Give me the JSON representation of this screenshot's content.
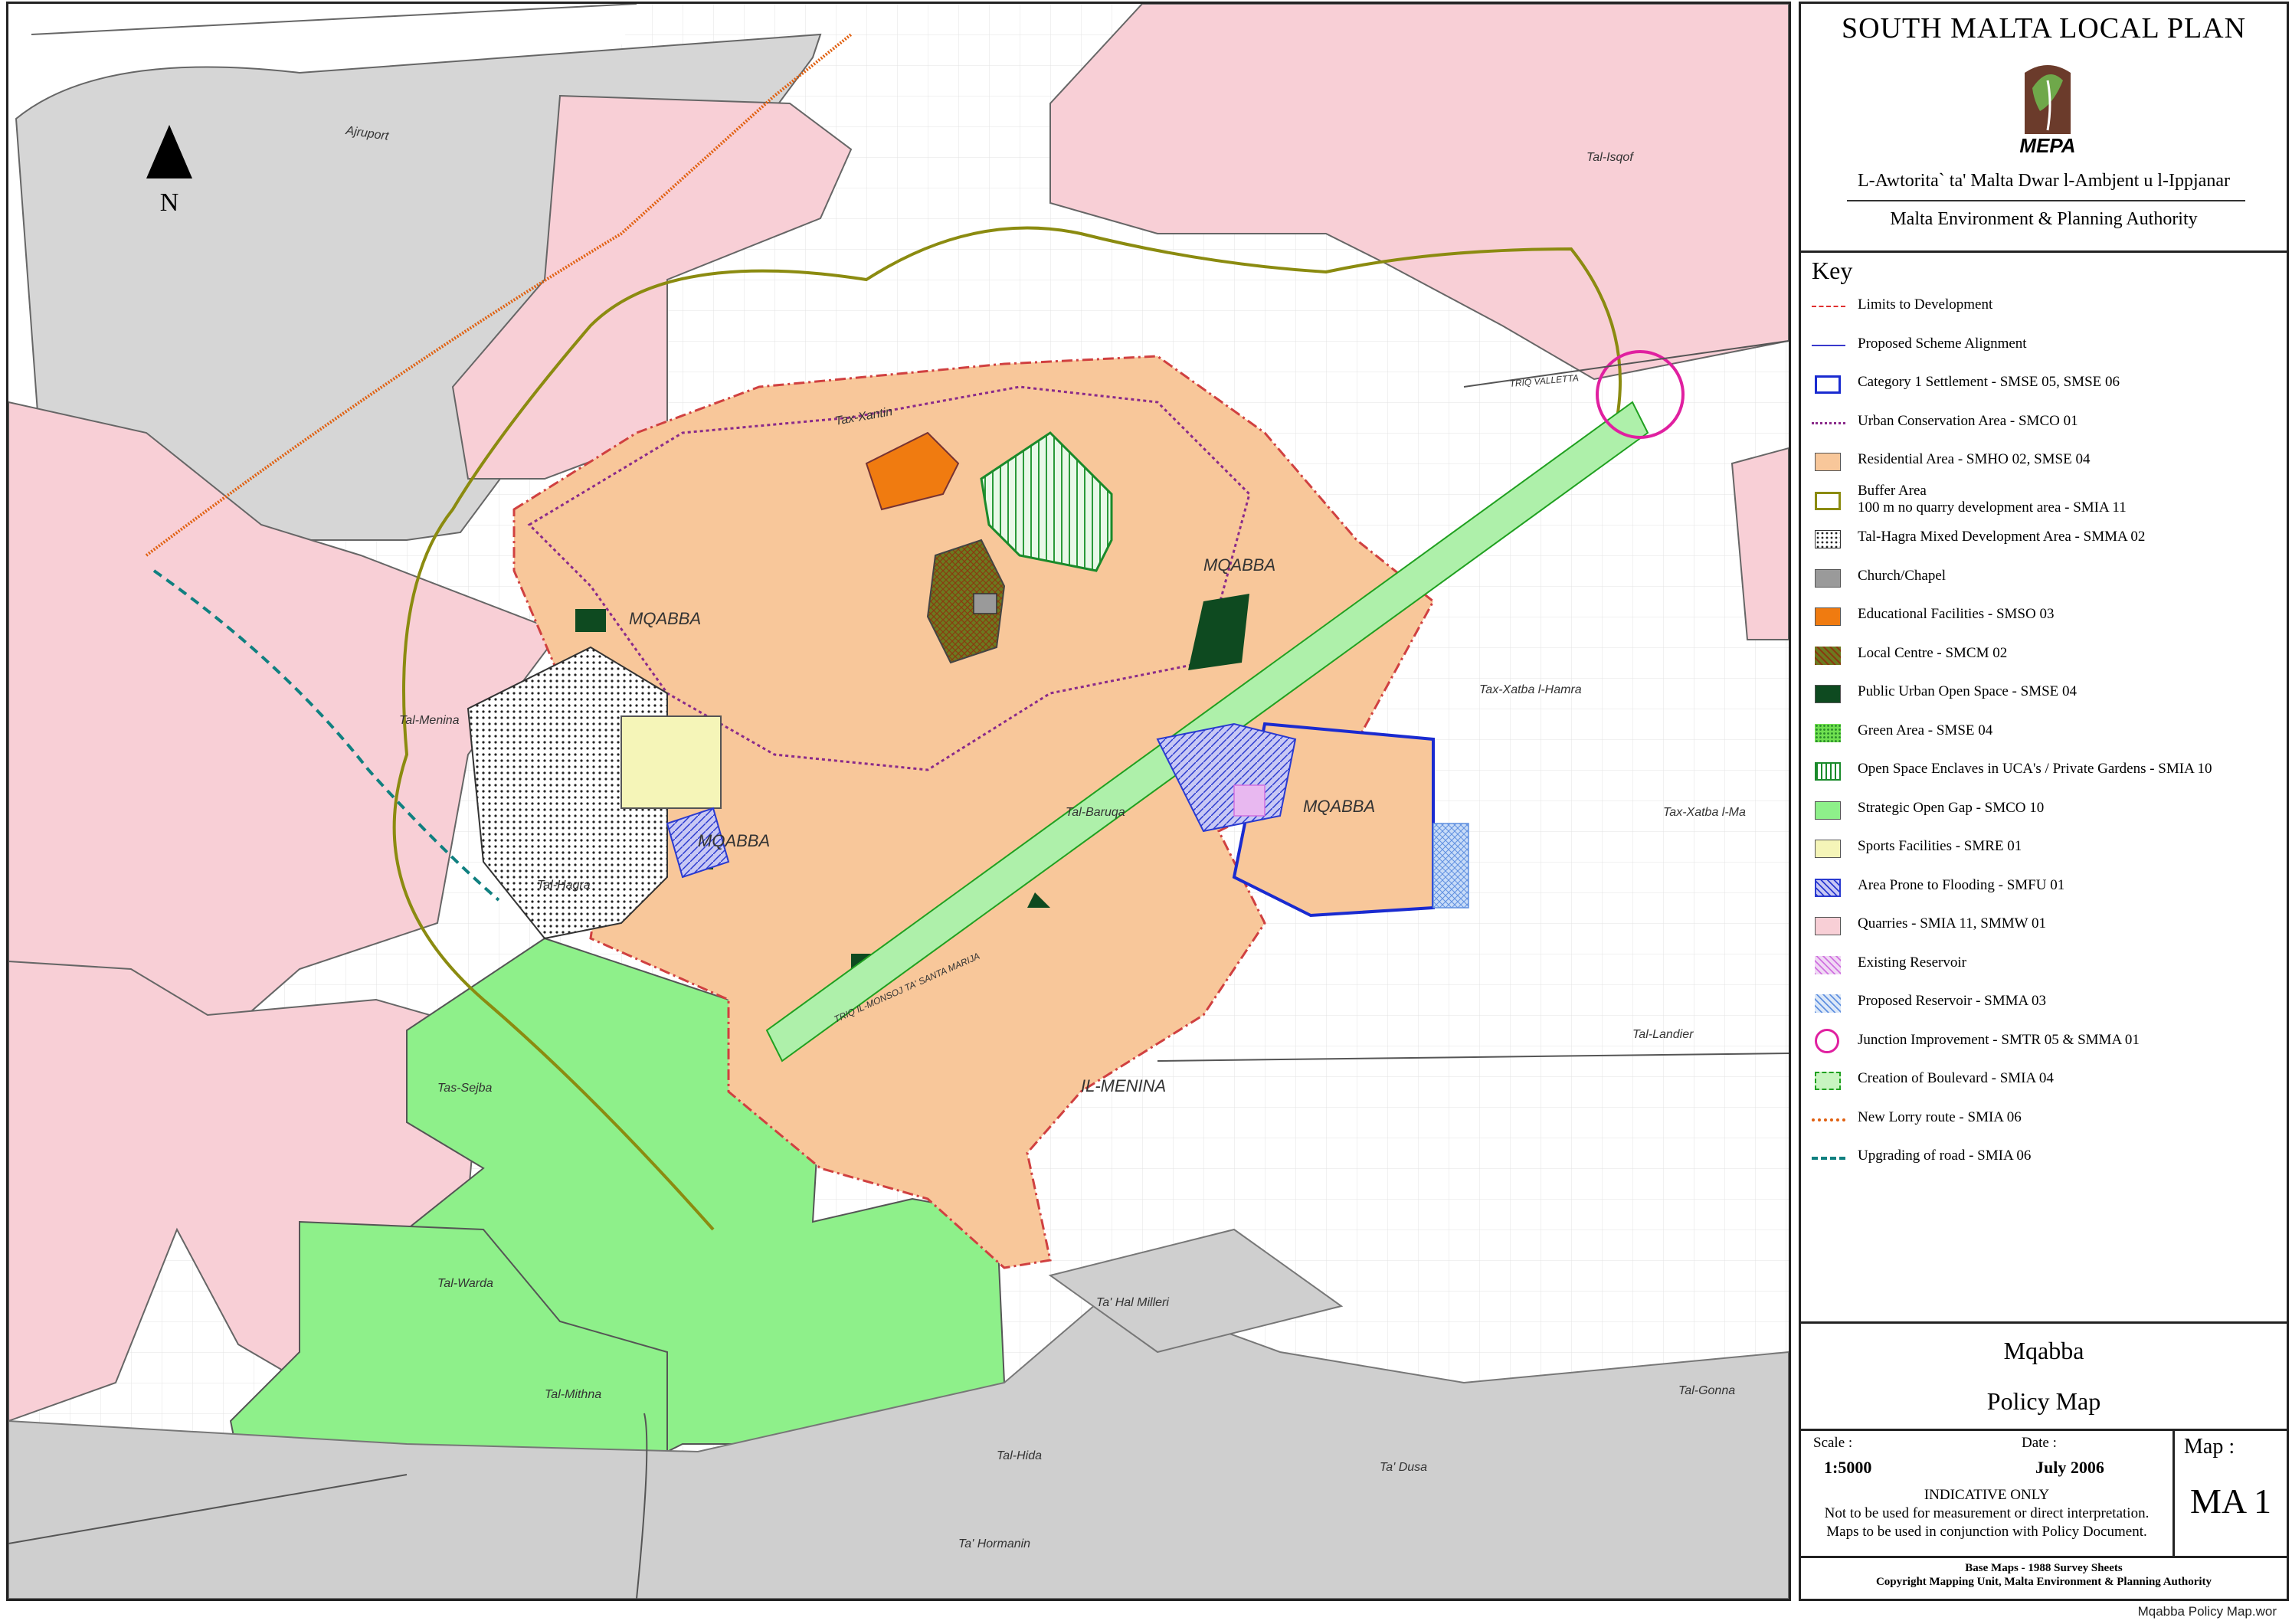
{
  "panel": {
    "plan_title": "SOUTH MALTA LOCAL PLAN",
    "logo_text": "MEPA",
    "authority_mt": "L-Awtorita` ta' Malta Dwar l-Ambjent u l-Ippjanar",
    "authority_en": "Malta Environment & Planning Authority",
    "key_title": "Key",
    "legend": [
      {
        "label": "Limits to Development",
        "swatch": "line-dashdot",
        "color": "#e03030"
      },
      {
        "label": "Proposed Scheme Alignment",
        "swatch": "line-solid",
        "color": "#3a3acc"
      },
      {
        "label": "Category 1 Settlement - SMSE 05, SMSE 06",
        "swatch": "outline",
        "color": "#1a2bd0"
      },
      {
        "label": "Urban Conservation Area - SMCO 01",
        "swatch": "line-dotted",
        "color": "#8a2a8a"
      },
      {
        "label": "Residential Area - SMHO 02, SMSE 04",
        "swatch": "fill",
        "color": "#f8c79a"
      },
      {
        "label": "Buffer Area",
        "label2": "100 m no quarry development area - SMIA 11",
        "swatch": "outline",
        "color": "#8b8b10"
      },
      {
        "label": "Tal-Hagra Mixed Development Area - SMMA 02",
        "swatch": "dots",
        "color": "#333333"
      },
      {
        "label": "Church/Chapel",
        "swatch": "fill",
        "color": "#9a9a9a"
      },
      {
        "label": "Educational Facilities - SMSO 03",
        "swatch": "fill",
        "color": "#f07b10"
      },
      {
        "label": "Local Centre - SMCM 02",
        "swatch": "hatch-brown",
        "color": "#7a5a10"
      },
      {
        "label": "Public Urban Open Space - SMSE 04",
        "swatch": "fill",
        "color": "#0e4a20"
      },
      {
        "label": "Green Area - SMSE 04",
        "swatch": "dots-green",
        "color": "#5fd040"
      },
      {
        "label": "Open Space Enclaves in UCA's / Private Gardens - SMIA 10",
        "swatch": "vlines",
        "color": "#1a8a2a"
      },
      {
        "label": "Strategic Open Gap - SMCO 10",
        "swatch": "fill",
        "color": "#8ef08a"
      },
      {
        "label": "Sports Facilities - SMRE 01",
        "swatch": "fill",
        "color": "#f5f5b8"
      },
      {
        "label": "Area Prone to Flooding - SMFU 01",
        "swatch": "hatch-blue",
        "color": "#2a3ad0"
      },
      {
        "label": "Quarries - SMIA 11, SMMW 01",
        "swatch": "fill",
        "color": "#f8cfd6"
      },
      {
        "label": "Existing Reservoir",
        "swatch": "hatch-pink",
        "color": "#d070e0"
      },
      {
        "label": "Proposed Reservoir - SMMA 03",
        "swatch": "hatch-lightblue",
        "color": "#6090e0"
      },
      {
        "label": "Junction Improvement - SMTR 05 & SMMA 01",
        "swatch": "circle",
        "color": "#e020a0"
      },
      {
        "label": "Creation of Boulevard - SMIA 04",
        "swatch": "dashbox",
        "color": "#20a020"
      },
      {
        "label": "New Lorry route - SMIA 06",
        "swatch": "line-orange",
        "color": "#e06010"
      },
      {
        "label": "Upgrading of road - SMIA 06",
        "swatch": "line-teal",
        "color": "#108080"
      }
    ],
    "place_name": "Mqabba",
    "map_type": "Policy Map",
    "scale_label": "Scale :",
    "scale_value": "1:5000",
    "date_label": "Date :",
    "date_value": "July 2006",
    "map_label": "Map :",
    "map_number": "MA 1",
    "indicative": "INDICATIVE ONLY",
    "disclaimer_1": "Not to be used for measurement or direct interpretation.",
    "disclaimer_2": "Maps to be used in conjunction with Policy Document.",
    "base_maps": "Base Maps - 1988 Survey Sheets",
    "copyright": "Copyright Mapping Unit, Malta Environment & Planning Authority"
  },
  "map": {
    "north_label": "N",
    "place_labels": {
      "airport": "Ajruport",
      "isqof": "Tal-Isqof",
      "xantin": "Tax-Xantin",
      "mqabba1": "MQABBA",
      "mqabba2": "MQABBA",
      "mqabba3": "MQABBA",
      "mqabba4": "MQABBA",
      "menina": "Tal-Menina",
      "hagra": "Tal-Hagra",
      "baruqa": "Tal-Baruqa",
      "xatba1": "Tax-Xatba l-Hamra",
      "xatba2": "Tax-Xatba l-Ma",
      "sejba": "Tas-Sejba",
      "ilmenina": "IL-MENINA",
      "landier": "Tal-Landier",
      "warda": "Tal-Warda",
      "mithna": "Tal-Mithna",
      "hal_milleri": "Ta' Hal Milleri",
      "gonna": "Tal-Gonna",
      "hida": "Tal-Hida",
      "dusa": "Ta' Dusa",
      "hormanin": "Ta' Hormanin"
    },
    "road_labels": {
      "valletta": "TRIQ VALLETTA",
      "santa_marija": "TRIQ IL-MONSOJ TA' SANTA MARIJA"
    }
  },
  "filename": "Mqabba Policy Map.wor"
}
